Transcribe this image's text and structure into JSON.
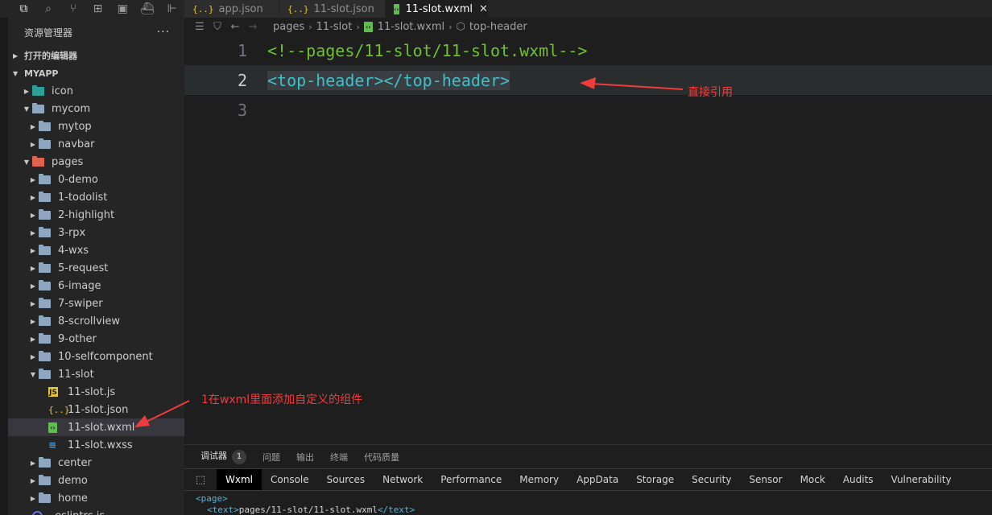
{
  "tabs": [
    {
      "icon": "{..}",
      "label": "app.json",
      "active": false
    },
    {
      "icon": "{..}",
      "label": "11-slot.json",
      "active": false
    },
    {
      "icon": "wxml",
      "label": "11-slot.wxml",
      "active": true
    }
  ],
  "tab_close": "✕",
  "sidebar": {
    "title": "资源管理器",
    "more": "···",
    "sections": {
      "open_editors": "打开的编辑器",
      "project": "MYAPP"
    },
    "tree": [
      {
        "label": "icon",
        "kind": "folder-teal",
        "depth": 1,
        "twisty": "▸"
      },
      {
        "label": "mycom",
        "kind": "folder-open",
        "depth": 1,
        "twisty": "▾"
      },
      {
        "label": "mytop",
        "kind": "folder",
        "depth": 2,
        "twisty": "▸"
      },
      {
        "label": "navbar",
        "kind": "folder",
        "depth": 2,
        "twisty": "▸"
      },
      {
        "label": "pages",
        "kind": "folder-red",
        "depth": 1,
        "twisty": "▾"
      },
      {
        "label": "0-demo",
        "kind": "folder",
        "depth": 2,
        "twisty": "▸"
      },
      {
        "label": "1-todolist",
        "kind": "folder",
        "depth": 2,
        "twisty": "▸"
      },
      {
        "label": "2-highlight",
        "kind": "folder",
        "depth": 2,
        "twisty": "▸"
      },
      {
        "label": "3-rpx",
        "kind": "folder",
        "depth": 2,
        "twisty": "▸"
      },
      {
        "label": "4-wxs",
        "kind": "folder",
        "depth": 2,
        "twisty": "▸"
      },
      {
        "label": "5-request",
        "kind": "folder",
        "depth": 2,
        "twisty": "▸"
      },
      {
        "label": "6-image",
        "kind": "folder",
        "depth": 2,
        "twisty": "▸"
      },
      {
        "label": "7-swiper",
        "kind": "folder",
        "depth": 2,
        "twisty": "▸"
      },
      {
        "label": "8-scrollview",
        "kind": "folder",
        "depth": 2,
        "twisty": "▸"
      },
      {
        "label": "9-other",
        "kind": "folder",
        "depth": 2,
        "twisty": "▸"
      },
      {
        "label": "10-selfcomponent",
        "kind": "folder",
        "depth": 2,
        "twisty": "▸"
      },
      {
        "label": "11-slot",
        "kind": "folder",
        "depth": 2,
        "twisty": "▾"
      },
      {
        "label": "11-slot.js",
        "kind": "js",
        "depth": 3,
        "twisty": ""
      },
      {
        "label": "11-slot.json",
        "kind": "json",
        "depth": 3,
        "twisty": ""
      },
      {
        "label": "11-slot.wxml",
        "kind": "wxml",
        "depth": 3,
        "twisty": "",
        "selected": true
      },
      {
        "label": "11-slot.wxss",
        "kind": "wxss",
        "depth": 3,
        "twisty": ""
      },
      {
        "label": "center",
        "kind": "folder",
        "depth": 2,
        "twisty": "▸"
      },
      {
        "label": "demo",
        "kind": "folder",
        "depth": 2,
        "twisty": "▸"
      },
      {
        "label": "home",
        "kind": "folder",
        "depth": 2,
        "twisty": "▸"
      },
      {
        "label": ".eslintrc.js",
        "kind": "eslint",
        "depth": 1,
        "twisty": ""
      }
    ]
  },
  "breadcrumb": {
    "items": [
      "pages",
      "11-slot",
      "11-slot.wxml",
      "top-header"
    ]
  },
  "editor": {
    "lines": [
      {
        "num": "1",
        "text": "<!--pages/11-slot/11-slot.wxml-->"
      },
      {
        "num": "2",
        "open_tag": "<top-header>",
        "close_tag": "</top-header>"
      },
      {
        "num": "3",
        "text": ""
      }
    ]
  },
  "annotations": {
    "direct_reference": "直接引用",
    "add_component": "1在wxml里面添加自定义的组件"
  },
  "panel": {
    "tabs": [
      "调试器",
      "问题",
      "输出",
      "终端",
      "代码质量"
    ],
    "badge": "1"
  },
  "devtools": {
    "tabs": [
      "Wxml",
      "Console",
      "Sources",
      "Network",
      "Performance",
      "Memory",
      "AppData",
      "Storage",
      "Security",
      "Sensor",
      "Mock",
      "Audits",
      "Vulnerability"
    ],
    "active": "Wxml"
  },
  "console": {
    "line1": "<page>",
    "line2_open": "<text>",
    "line2_text": "pages/11-slot/11-slot.wxml",
    "line2_close": "</text>"
  },
  "colors": {
    "comment": "#6ec22b",
    "tag": "#3ec0c9",
    "annotation": "#f03c3c",
    "background": "#1e1e1e",
    "sidebar": "#252526"
  }
}
